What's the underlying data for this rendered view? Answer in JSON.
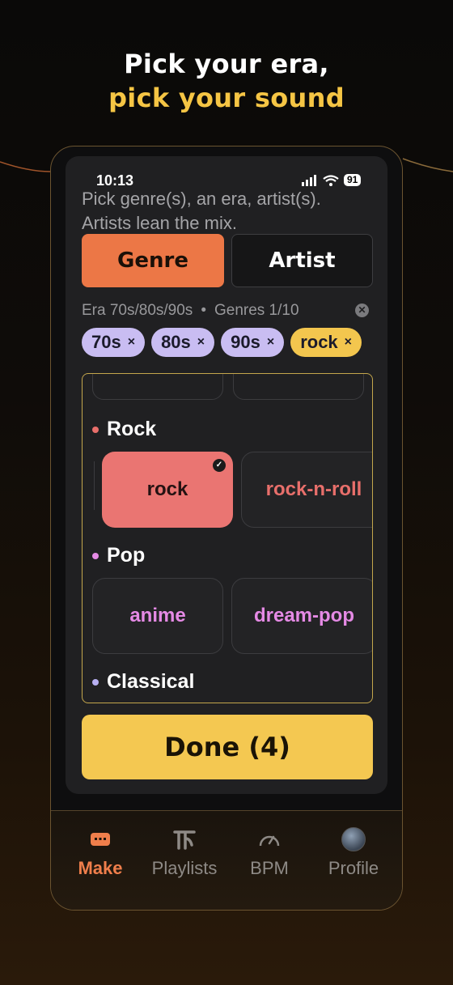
{
  "headline": {
    "line1": "Pick your era,",
    "line2": "pick your sound"
  },
  "status_bar": {
    "time": "10:13",
    "battery": "91"
  },
  "intro_text": "Pick genre(s), an era, artist(s). Artists lean the mix.",
  "tabs": [
    {
      "label": "Genre",
      "active": true
    },
    {
      "label": "Artist",
      "active": false
    }
  ],
  "filters": {
    "era": "Era 70s/80s/90s",
    "separator": "•",
    "genres": "Genres 1/10"
  },
  "selected_chips": [
    {
      "label": "70s",
      "kind": "era"
    },
    {
      "label": "80s",
      "kind": "era"
    },
    {
      "label": "90s",
      "kind": "era"
    },
    {
      "label": "rock",
      "kind": "genre"
    }
  ],
  "chip_remove_glyph": "×",
  "sections": [
    {
      "name": "Rock",
      "dot_color": "#e86f6b",
      "tiles": [
        {
          "label": "rock",
          "selected": true
        },
        {
          "label": "rock-n-roll",
          "selected": false
        }
      ]
    },
    {
      "name": "Pop",
      "dot_color": "#e58ae5",
      "tiles": [
        {
          "label": "anime",
          "selected": false
        },
        {
          "label": "dream-pop",
          "selected": false
        }
      ]
    },
    {
      "name": "Classical",
      "dot_color": "#b8b0f2",
      "tiles": []
    }
  ],
  "done_button": "Done (4)",
  "tab_bar": [
    {
      "label": "Make",
      "icon": "radio-icon",
      "active": true
    },
    {
      "label": "Playlists",
      "icon": "playlists-icon",
      "active": false
    },
    {
      "label": "BPM",
      "icon": "speedometer-icon",
      "active": false
    },
    {
      "label": "Profile",
      "icon": "avatar",
      "active": false
    }
  ],
  "colors": {
    "accent_orange": "#ec7746",
    "accent_yellow": "#f4c851",
    "era_chip": "#c9bdf2",
    "rock_tile": "#ea7572",
    "pop_text": "#e58ae5",
    "rock_text": "#e86f6b"
  }
}
